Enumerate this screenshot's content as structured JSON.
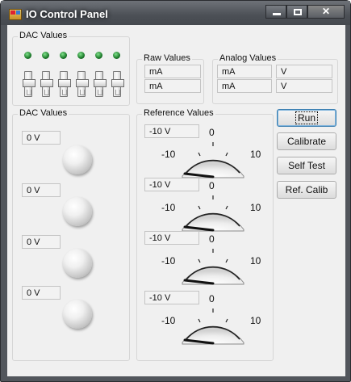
{
  "window": {
    "title": "IO Control Panel"
  },
  "dac_group_top": {
    "label": "DAC Values"
  },
  "raw_group": {
    "label": "Raw Values",
    "rows": [
      "mA",
      "mA"
    ]
  },
  "analog_group": {
    "label": "Analog Values",
    "rows": [
      {
        "a": "mA",
        "b": "V"
      },
      {
        "a": "mA",
        "b": "V"
      }
    ]
  },
  "dac_group": {
    "label": "DAC Values",
    "values": [
      "0 V",
      "0 V",
      "0 V",
      "0 V"
    ]
  },
  "ref_group": {
    "label": "Reference Values",
    "items": [
      {
        "value": "-10 V",
        "min": "-10",
        "mid": "0",
        "max": "10"
      },
      {
        "value": "-10 V",
        "min": "-10",
        "mid": "0",
        "max": "10"
      },
      {
        "value": "-10 V",
        "min": "-10",
        "mid": "0",
        "max": "10"
      },
      {
        "value": "-10 V",
        "min": "-10",
        "mid": "0",
        "max": "10"
      }
    ]
  },
  "buttons": {
    "run": "Run",
    "calibrate": "Calibrate",
    "self_test": "Self Test",
    "ref_calib": "Ref. Calib"
  },
  "icons": [
    "app-icon",
    "minimize-icon",
    "maximize-icon",
    "close-icon"
  ]
}
